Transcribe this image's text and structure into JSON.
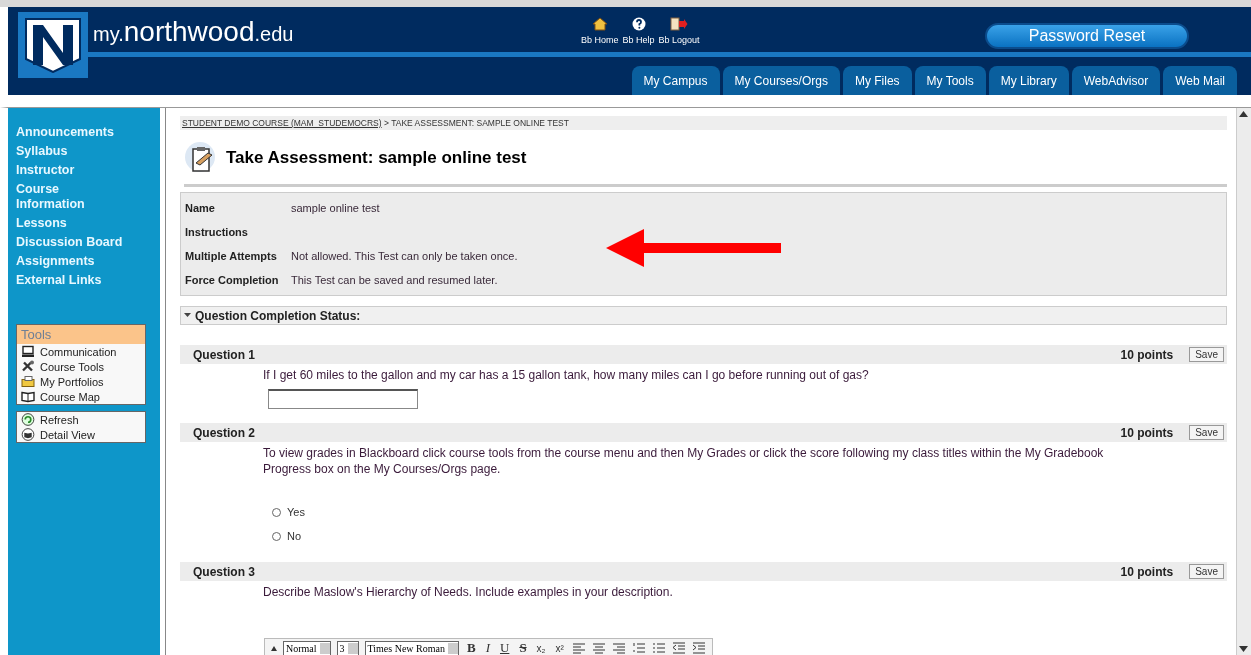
{
  "header": {
    "logo_prefix": "my.",
    "logo_main": "northwood",
    "logo_suffix": ".edu",
    "links": [
      {
        "kind": "home",
        "label": "Bb Home"
      },
      {
        "kind": "help",
        "label": "Bb Help"
      },
      {
        "kind": "logout",
        "label": "Bb Logout"
      }
    ],
    "password_button": "Password Reset",
    "tabs": [
      {
        "label": "My Campus",
        "selected": false
      },
      {
        "label": "My Courses/Orgs",
        "selected": false
      },
      {
        "label": "My Files",
        "selected": false
      },
      {
        "label": "My Tools",
        "selected": false
      },
      {
        "label": "My Library",
        "selected": false
      },
      {
        "label": "WebAdvisor",
        "selected": false
      },
      {
        "label": "Web Mail",
        "selected": false
      }
    ]
  },
  "sidebar": {
    "items": [
      "Announcements",
      "Syllabus",
      "Instructor",
      "Course Information",
      "Lessons",
      "Discussion Board",
      "Assignments",
      "External Links"
    ],
    "tools_title": "Tools",
    "tools": [
      {
        "kind": "communication",
        "label": "Communication"
      },
      {
        "kind": "course-tools",
        "label": "Course Tools"
      },
      {
        "kind": "portfolios",
        "label": "My Portfolios"
      },
      {
        "kind": "map",
        "label": "Course Map"
      }
    ],
    "views": [
      {
        "kind": "refresh",
        "label": "Refresh"
      },
      {
        "kind": "detail",
        "label": "Detail View"
      }
    ]
  },
  "breadcrumb": {
    "link": "STUDENT DEMO COURSE (MAM_STUDEMOCRS)",
    "current": "> TAKE ASSESSMENT: SAMPLE ONLINE TEST"
  },
  "title": "Take Assessment: sample online test",
  "info": [
    {
      "label": "Name",
      "value": "sample online test"
    },
    {
      "label": "Instructions"
    },
    {
      "label": "Multiple Attempts",
      "value": "Not allowed. This Test can only be taken once."
    },
    {
      "label": "Force Completion",
      "value": "This Test can be saved and resumed later."
    }
  ],
  "completion_status": {
    "label": "Question Completion Status:",
    "expanded": false
  },
  "questions": [
    {
      "kind": "short_answer",
      "title": "Question 1",
      "points": "10 points",
      "save": "Save",
      "text": "If I get 60 miles to the gallon and my car has a 15 gallon tank, how many miles can I go before running out of gas?"
    },
    {
      "kind": "choice",
      "title": "Question 2",
      "points": "10 points",
      "save": "Save",
      "text": "To view grades in Blackboard click course tools from the course menu and then My Grades or click the score following my class titles within the My Gradebook Progress box on the My Courses/Orgs page.",
      "options": [
        {
          "label": "Yes",
          "selected": false
        },
        {
          "label": "No",
          "selected": false
        }
      ]
    },
    {
      "kind": "essay",
      "title": "Question 3",
      "points": "10 points",
      "save": "Save",
      "text": "Describe Maslow's Hierarchy of Needs.  Include examples in your description.",
      "toolbar": {
        "selects": [
          "Normal",
          "3",
          "Times New Roman"
        ],
        "styles": [
          {
            "kind": "bold",
            "label": "B"
          },
          {
            "kind": "italic",
            "label": "I"
          },
          {
            "kind": "underline",
            "label": "U"
          },
          {
            "kind": "strike",
            "label": "S"
          }
        ],
        "scripts": [
          "x₂",
          "x²"
        ]
      }
    }
  ]
}
